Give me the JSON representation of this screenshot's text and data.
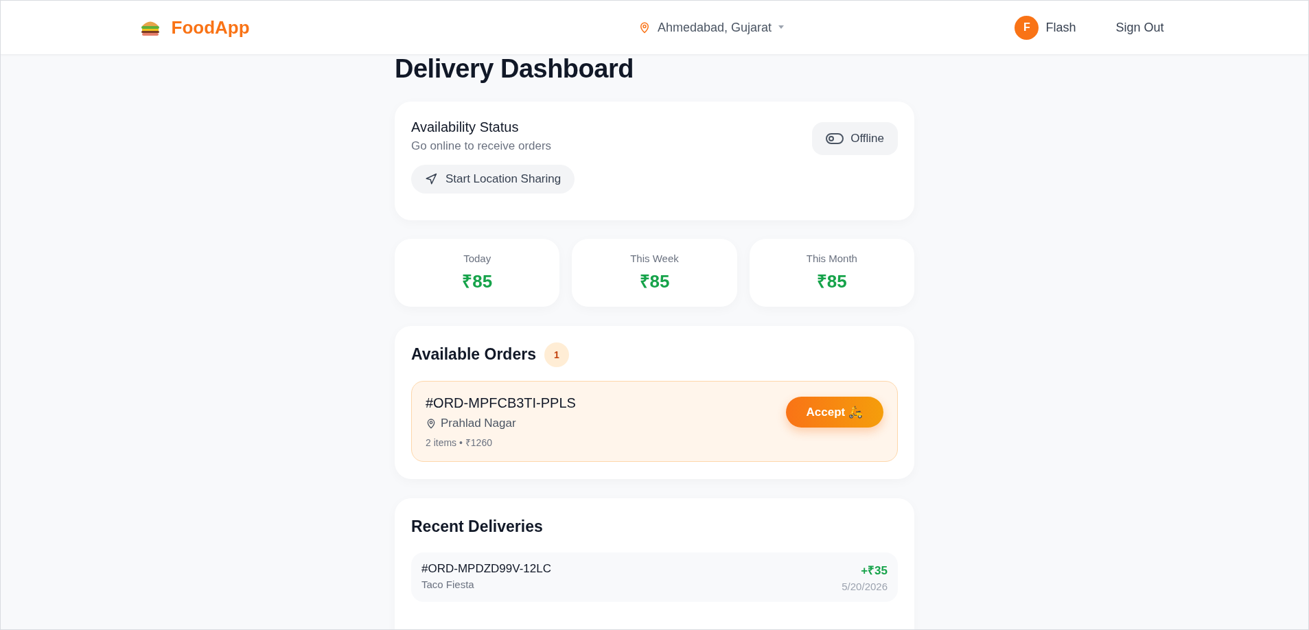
{
  "header": {
    "brand": "FoodApp",
    "location": "Ahmedabad, Gujarat",
    "user_initial": "F",
    "user_name": "Flash",
    "sign_out": "Sign Out"
  },
  "title": "Delivery Dashboard",
  "availability": {
    "heading": "Availability Status",
    "subtitle": "Go online to receive orders",
    "online": false,
    "status_label": "Offline",
    "location_button": "Start Location Sharing"
  },
  "earnings": [
    {
      "label": "Today",
      "amount": "₹85"
    },
    {
      "label": "This Week",
      "amount": "₹85"
    },
    {
      "label": "This Month",
      "amount": "₹85"
    }
  ],
  "available_orders": {
    "heading": "Available Orders",
    "count": "1",
    "orders": [
      {
        "id": "#ORD-MPFCB3TI-PPLS",
        "area": "Prahlad Nagar",
        "summary": "2 items • ₹1260",
        "action": "Accept 🛵"
      }
    ]
  },
  "recent_deliveries": {
    "heading": "Recent Deliveries",
    "rows": [
      {
        "id": "#ORD-MPDZD99V-12LC",
        "restaurant": "Taco Fiesta",
        "earning": "+₹35",
        "date": "5/20/2026"
      }
    ]
  }
}
